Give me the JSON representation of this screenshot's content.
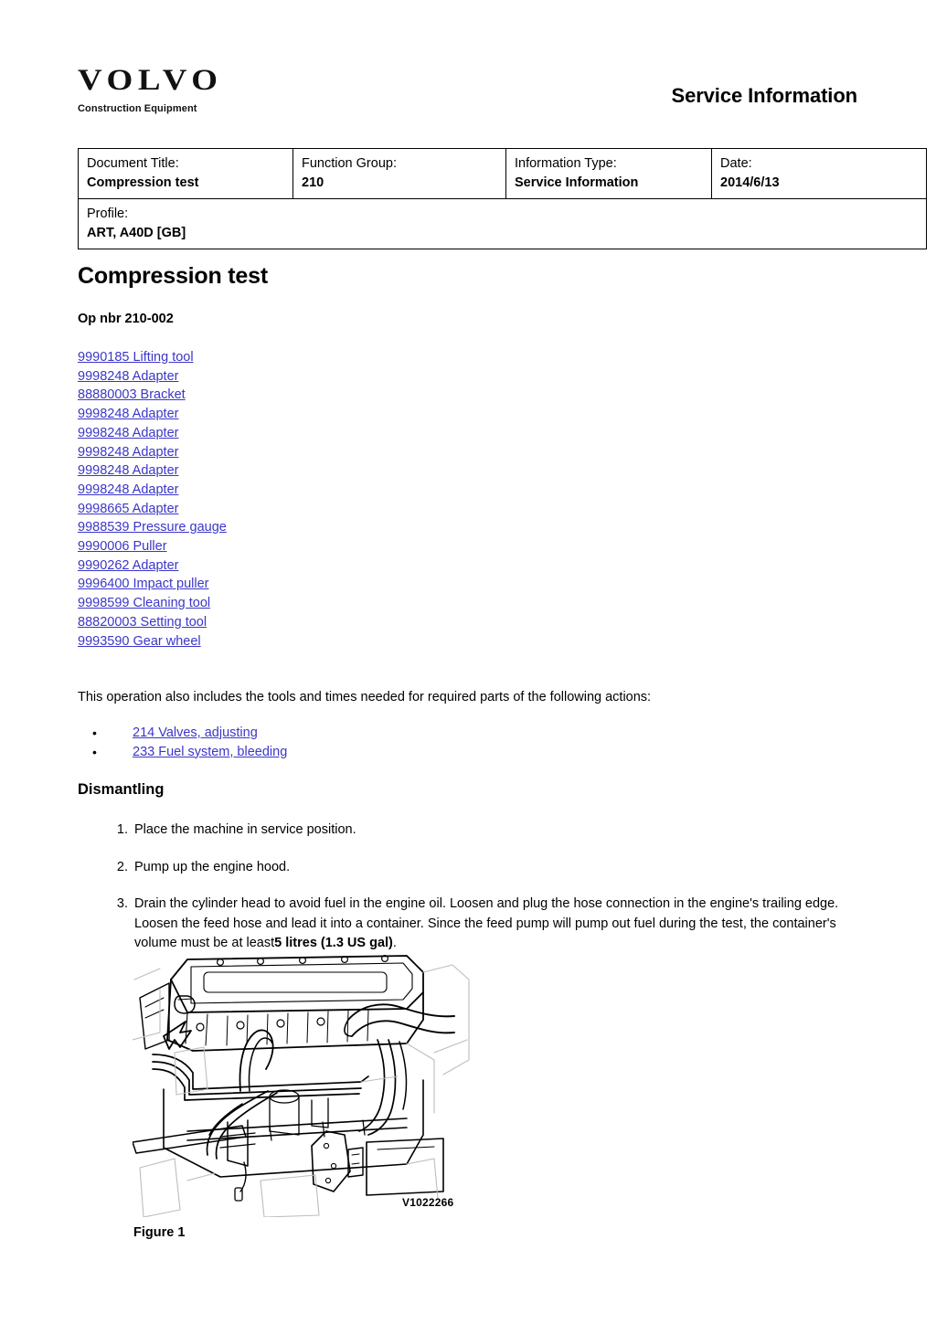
{
  "header": {
    "brand": "VOLVO",
    "brand_sub": "Construction Equipment",
    "right_title": "Service Information"
  },
  "info_table": {
    "row1": [
      {
        "label": "Document Title:",
        "value": "Compression test"
      },
      {
        "label": "Function Group:",
        "value": "210"
      },
      {
        "label": "Information Type:",
        "value": "Service Information"
      },
      {
        "label": "Date:",
        "value": "2014/6/13"
      }
    ],
    "row2": {
      "label": "Profile:",
      "value": "ART, A40D [GB]"
    }
  },
  "document": {
    "title": "Compression test",
    "op_nbr": "Op nbr 210-002",
    "tools": [
      "9990185 Lifting tool",
      "9998248 Adapter",
      "88880003 Bracket",
      "9998248 Adapter",
      "9998248 Adapter",
      "9998248 Adapter",
      "9998248 Adapter",
      "9998248 Adapter",
      "9998665 Adapter",
      "9988539 Pressure gauge",
      "9990006 Puller",
      "9990262 Adapter",
      "9996400 Impact puller",
      "9998599 Cleaning tool",
      "88820003 Setting tool",
      "9993590 Gear wheel"
    ],
    "intro_paragraph": "This operation also includes the tools and times needed for required parts of the following actions:",
    "bullet": "•",
    "related_actions": [
      "214 Valves, adjusting",
      "233 Fuel system, bleeding"
    ],
    "section_heading": "Dismantling",
    "steps": [
      {
        "num": "1.",
        "text": "Place the machine in service position."
      },
      {
        "num": "2.",
        "text": "Pump up the engine hood."
      },
      {
        "num": "3.",
        "text_before": "Drain the cylinder head to avoid fuel in the engine oil. Loosen and plug the hose connection in the engine's trailing edge. Loosen the feed hose and lead it into a container. Since the feed pump will pump out fuel during the test, the container's volume must be at least",
        "text_bold": "5 litres (1.3 US gal)",
        "text_after": "."
      }
    ],
    "figure": {
      "reference": "V1022266",
      "caption": "Figure 1"
    }
  },
  "colors": {
    "link": "#3b36c8",
    "text": "#000000",
    "border": "#000000",
    "background": "#ffffff"
  }
}
